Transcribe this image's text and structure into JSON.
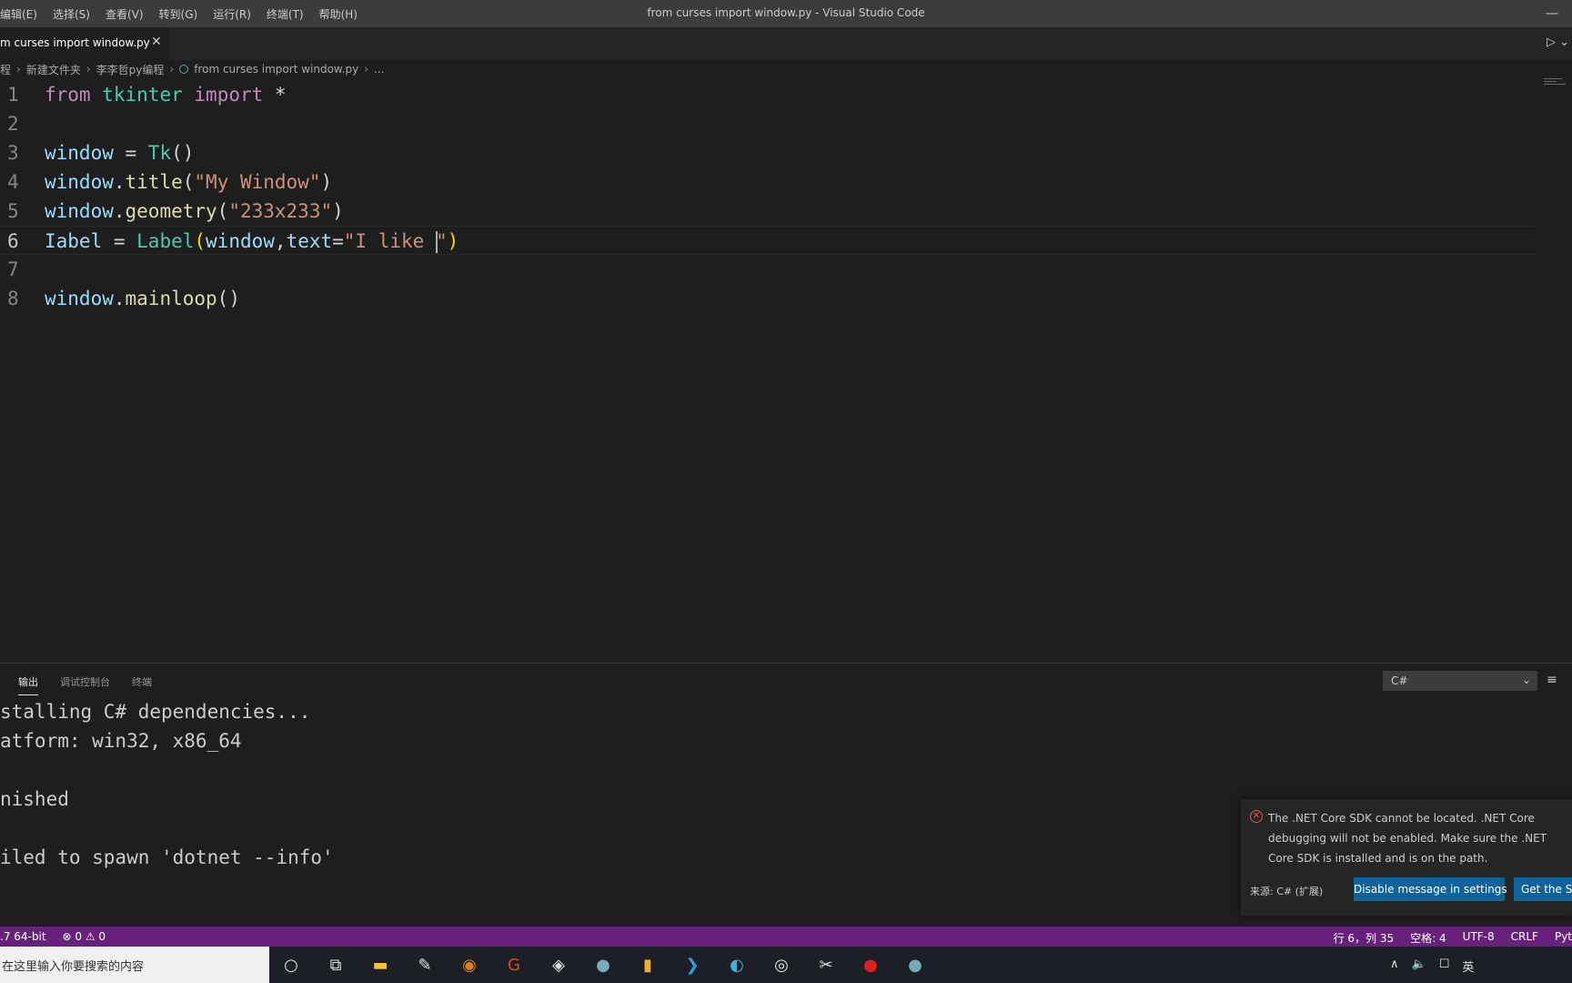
{
  "window": {
    "title": "from curses import window.py - Visual Studio Code"
  },
  "menu": [
    "编辑(E)",
    "选择(S)",
    "查看(V)",
    "转到(G)",
    "运行(R)",
    "终端(T)",
    "帮助(H)"
  ],
  "tab": {
    "label": "m curses import window.py",
    "close": "✕"
  },
  "breadcrumb": [
    "程",
    "新建文件夹",
    "李李哲py编程",
    "from curses import window.py",
    "..."
  ],
  "editor": {
    "active_line": 6,
    "lines": [
      {
        "n": "1",
        "tokens": [
          [
            "kw",
            "from"
          ],
          [
            "op",
            " "
          ],
          [
            "mod",
            "tkinter"
          ],
          [
            "op",
            " "
          ],
          [
            "kw",
            "import"
          ],
          [
            "op",
            " *"
          ]
        ]
      },
      {
        "n": "2",
        "tokens": []
      },
      {
        "n": "3",
        "tokens": [
          [
            "var",
            "window"
          ],
          [
            "op",
            " = "
          ],
          [
            "cls",
            "Tk"
          ],
          [
            "op",
            "()"
          ]
        ]
      },
      {
        "n": "4",
        "tokens": [
          [
            "var",
            "window"
          ],
          [
            "op",
            "."
          ],
          [
            "fn",
            "title"
          ],
          [
            "op",
            "("
          ],
          [
            "str",
            "\"My Window\""
          ],
          [
            "op",
            ")"
          ]
        ]
      },
      {
        "n": "5",
        "tokens": [
          [
            "var",
            "window"
          ],
          [
            "op",
            "."
          ],
          [
            "fn",
            "geometry"
          ],
          [
            "op",
            "("
          ],
          [
            "str",
            "\"233x233\""
          ],
          [
            "op",
            ")"
          ]
        ]
      },
      {
        "n": "6",
        "tokens": [
          [
            "var",
            "Iabel"
          ],
          [
            "op",
            " = "
          ],
          [
            "cls",
            "Label"
          ],
          [
            "bracket",
            "("
          ],
          [
            "var",
            "window"
          ],
          [
            "op",
            ","
          ],
          [
            "var",
            "text"
          ],
          [
            "op",
            "="
          ],
          [
            "str",
            "\"I like "
          ],
          [
            "cursor",
            ""
          ],
          [
            "str",
            "\""
          ],
          [
            "bracket",
            ")"
          ]
        ]
      },
      {
        "n": "7",
        "tokens": []
      },
      {
        "n": "8",
        "tokens": [
          [
            "var",
            "window"
          ],
          [
            "op",
            "."
          ],
          [
            "fn",
            "mainloop"
          ],
          [
            "op",
            "()"
          ]
        ]
      }
    ]
  },
  "panel": {
    "tabs": [
      "输出",
      "调试控制台",
      "终端"
    ],
    "active_tab": 0,
    "channel": "C#",
    "output": [
      "stalling C# dependencies...",
      "atform: win32, x86_64",
      "",
      "nished",
      "",
      "iled to spawn 'dotnet --info'"
    ]
  },
  "notification": {
    "message": "The .NET Core SDK cannot be located. .NET Core debugging will not be enabled. Make sure the .NET Core SDK is installed and is on the path.",
    "source": "来源: C# (扩展)",
    "button_primary": "Disable message in settings",
    "button_secondary": "Get the SDK"
  },
  "statusbar": {
    "left": [
      ".7 64-bit",
      "⊗ 0 ⚠ 0"
    ],
    "right": [
      "行 6，列 35",
      "空格: 4",
      "UTF-8",
      "CRLF",
      "Pyt"
    ]
  },
  "taskbar": {
    "search_placeholder": "在这里输入你要搜索的内容",
    "icons": [
      "cortana-icon",
      "task-view-icon",
      "file-explorer-icon",
      "notepad-icon",
      "blender-icon",
      "g-app-icon",
      "unity-icon",
      "steam-icon",
      "folder-app-icon",
      "vscode-icon",
      "edge-icon",
      "obs-icon",
      "capcut-icon",
      "record-icon",
      "steam-icon-2"
    ],
    "tray": [
      "∧",
      "🔈",
      "☐",
      "英"
    ]
  }
}
